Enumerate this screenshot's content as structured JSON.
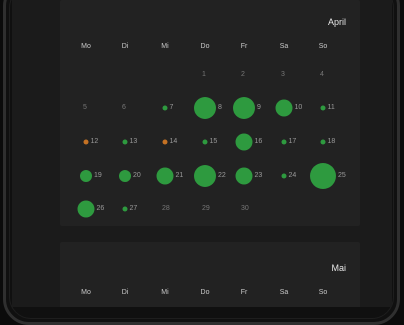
{
  "months": [
    {
      "name": "April",
      "weekdays": [
        "Mo",
        "Di",
        "Mi",
        "Do",
        "Fr",
        "Sa",
        "So"
      ],
      "first_weekday_index": 3,
      "days": [
        {
          "day": "1",
          "level": 0
        },
        {
          "day": "2",
          "level": 0
        },
        {
          "day": "3",
          "level": 0
        },
        {
          "day": "4",
          "level": 0
        },
        {
          "day": "5",
          "level": 0
        },
        {
          "day": "6",
          "level": 0
        },
        {
          "day": "7",
          "level": 1
        },
        {
          "day": "8",
          "level": 4
        },
        {
          "day": "9",
          "level": 4
        },
        {
          "day": "10",
          "level": 3
        },
        {
          "day": "11",
          "level": 1
        },
        {
          "day": "12",
          "level": 1,
          "color": "orange"
        },
        {
          "day": "13",
          "level": 1
        },
        {
          "day": "14",
          "level": 1,
          "color": "orange"
        },
        {
          "day": "15",
          "level": 1
        },
        {
          "day": "16",
          "level": 3
        },
        {
          "day": "17",
          "level": 1
        },
        {
          "day": "18",
          "level": 1
        },
        {
          "day": "19",
          "level": 2
        },
        {
          "day": "20",
          "level": 2
        },
        {
          "day": "21",
          "level": 3
        },
        {
          "day": "22",
          "level": 4
        },
        {
          "day": "23",
          "level": 3
        },
        {
          "day": "24",
          "level": 1
        },
        {
          "day": "25",
          "level": 5
        },
        {
          "day": "26",
          "level": 3
        },
        {
          "day": "27",
          "level": 1
        },
        {
          "day": "28",
          "level": 0
        },
        {
          "day": "29",
          "level": 0
        },
        {
          "day": "30",
          "level": 0
        }
      ]
    },
    {
      "name": "Mai",
      "weekdays": [
        "Mo",
        "Di",
        "Mi",
        "Do",
        "Fr",
        "Sa",
        "So"
      ]
    }
  ],
  "colors": {
    "green": "#2e9a3f",
    "orange": "#c57224"
  }
}
